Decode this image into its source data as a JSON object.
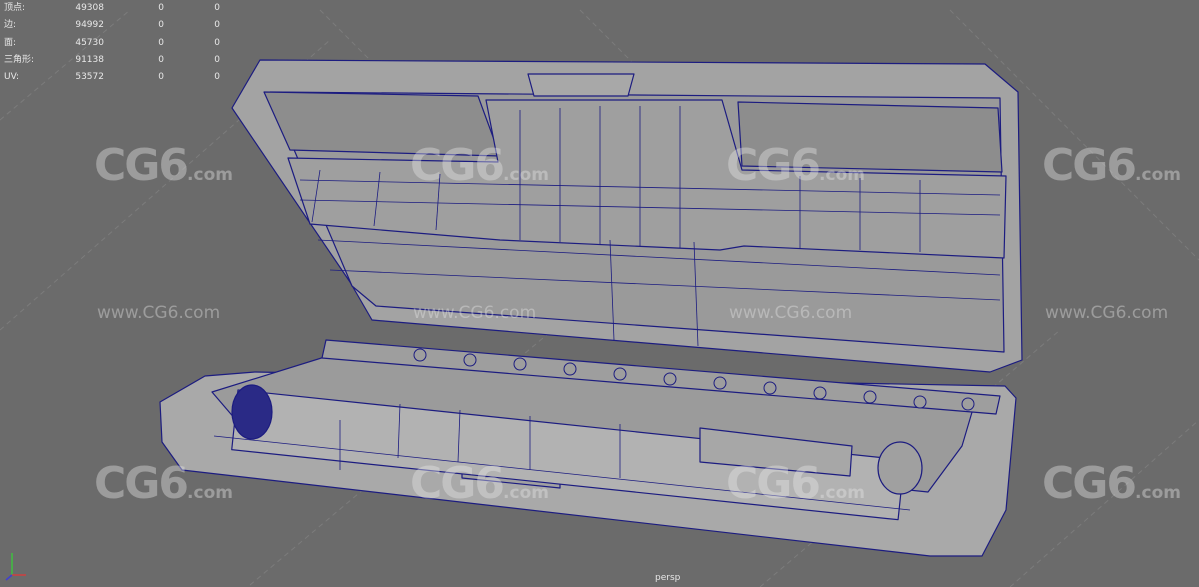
{
  "stats": [
    {
      "label": "顶点:",
      "v1": "49308",
      "v2": "0",
      "v3": "0"
    },
    {
      "label": "边:",
      "v1": "94992",
      "v2": "0",
      "v3": "0"
    },
    {
      "label": "面:",
      "v1": "45730",
      "v2": "0",
      "v3": "0"
    },
    {
      "label": "三角形:",
      "v1": "91138",
      "v2": "0",
      "v3": "0"
    },
    {
      "label": "UV:",
      "v1": "53572",
      "v2": "0",
      "v3": "0"
    }
  ],
  "watermark": {
    "logo": "CG6",
    "logo_suffix": ".com",
    "url": "www.CG6.com"
  },
  "camera_label": "persp",
  "colors": {
    "viewport_bg": "#6b6b6b",
    "wireframe": "#1c1c80",
    "model_fill": "#a6a6a6"
  }
}
